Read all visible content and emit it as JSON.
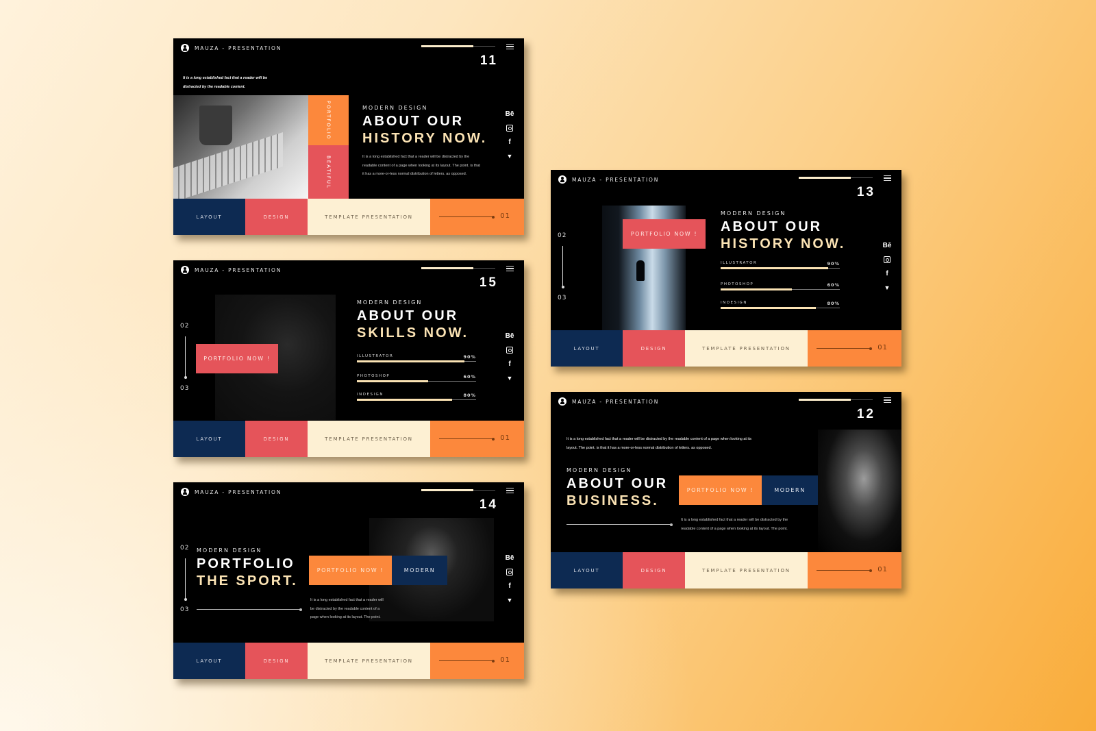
{
  "brand": "MAUZA - PRESENTATION",
  "colors": {
    "navy": "#0d2a52",
    "red": "#e5545a",
    "cream": "#fdf0d3",
    "orange": "#fc883c",
    "accent_text": "#fbe3b4",
    "background_light": "#fff2dc",
    "background_dark": "#f9ac3a"
  },
  "bottom_bar": {
    "layout": "LAYOUT",
    "design": "DESIGN",
    "template": "TEMPLATE PRESENTATION",
    "page": "01"
  },
  "social_icons": [
    "behance-icon",
    "instagram-icon",
    "facebook-icon",
    "twitter-icon"
  ],
  "social_glyphs": {
    "behance": "Bē",
    "facebook": "f",
    "twitter": "🐦"
  },
  "slides": {
    "s11": {
      "number": "11",
      "progress": 0.7,
      "intro_line1": "It is a long established fact that a reader will be",
      "intro_line2": "distracted by the readable content.",
      "tag_top": "PORTFOLIO",
      "tag_bottom": "BEATIFUL",
      "kicker": "MODERN DESIGN",
      "title_line1": "ABOUT OUR",
      "title_line2": "HISTORY NOW.",
      "body_line1": "It is a long established fact that a reader will be distracted by the",
      "body_line2": "readable content of a page when looking at its layout. The point. is that",
      "body_line3": "it has a more-or-less normal distribution of letters. as opposed."
    },
    "s15": {
      "number": "15",
      "progress": 0.7,
      "nav_from": "02",
      "nav_to": "03",
      "button": "PORTFOLIO NOW !",
      "kicker": "MODERN DESIGN",
      "title_line1": "ABOUT OUR",
      "title_line2": "SKILLS NOW.",
      "skills": [
        {
          "label": "ILLUSTRATOR",
          "pct_text": "90%",
          "value": 0.9
        },
        {
          "label": "PHOTOSHOP",
          "pct_text": "60%",
          "value": 0.6
        },
        {
          "label": "INDESIGN",
          "pct_text": "80%",
          "value": 0.8
        }
      ]
    },
    "s14": {
      "number": "14",
      "progress": 0.7,
      "nav_from": "02",
      "nav_to": "03",
      "kicker": "MODERN DESIGN",
      "title_line1": "PORTFOLIO",
      "title_line2": "THE SPORT.",
      "button_primary": "PORTFOLIO NOW !",
      "button_secondary": "MODERN",
      "body_line1": "It is a long established fact that a reader will",
      "body_line2": "be distracted by the readable content of a",
      "body_line3": "page when looking at its layout. The point."
    },
    "s13": {
      "number": "13",
      "progress": 0.7,
      "nav_from": "02",
      "nav_to": "03",
      "button": "PORTFOLIO NOW !",
      "kicker": "MODERN DESIGN",
      "title_line1": "ABOUT OUR",
      "title_line2": "HISTORY NOW.",
      "skills": [
        {
          "label": "ILLUSTRATOR",
          "pct_text": "90%",
          "value": 0.9
        },
        {
          "label": "PHOTOSHOP",
          "pct_text": "60%",
          "value": 0.6
        },
        {
          "label": "INDESIGN",
          "pct_text": "80%",
          "value": 0.8
        }
      ]
    },
    "s12": {
      "number": "12",
      "progress": 0.7,
      "intro_line1": "It is a long established fact that a reader will be distracted by the readable content of a page when looking at its",
      "intro_line2": "layout. The point. is that it has a more-or-less normal distribution of letters. as opposed.",
      "kicker": "MODERN DESIGN",
      "title_line1": "ABOUT OUR",
      "title_line2": "BUSINESS.",
      "button_primary": "PORTFOLIO NOW !",
      "button_secondary": "MODERN",
      "body_line1": "It is a long established fact that a reader will be distracted by the",
      "body_line2": "readable content of a page when looking at its layout. The point."
    }
  }
}
